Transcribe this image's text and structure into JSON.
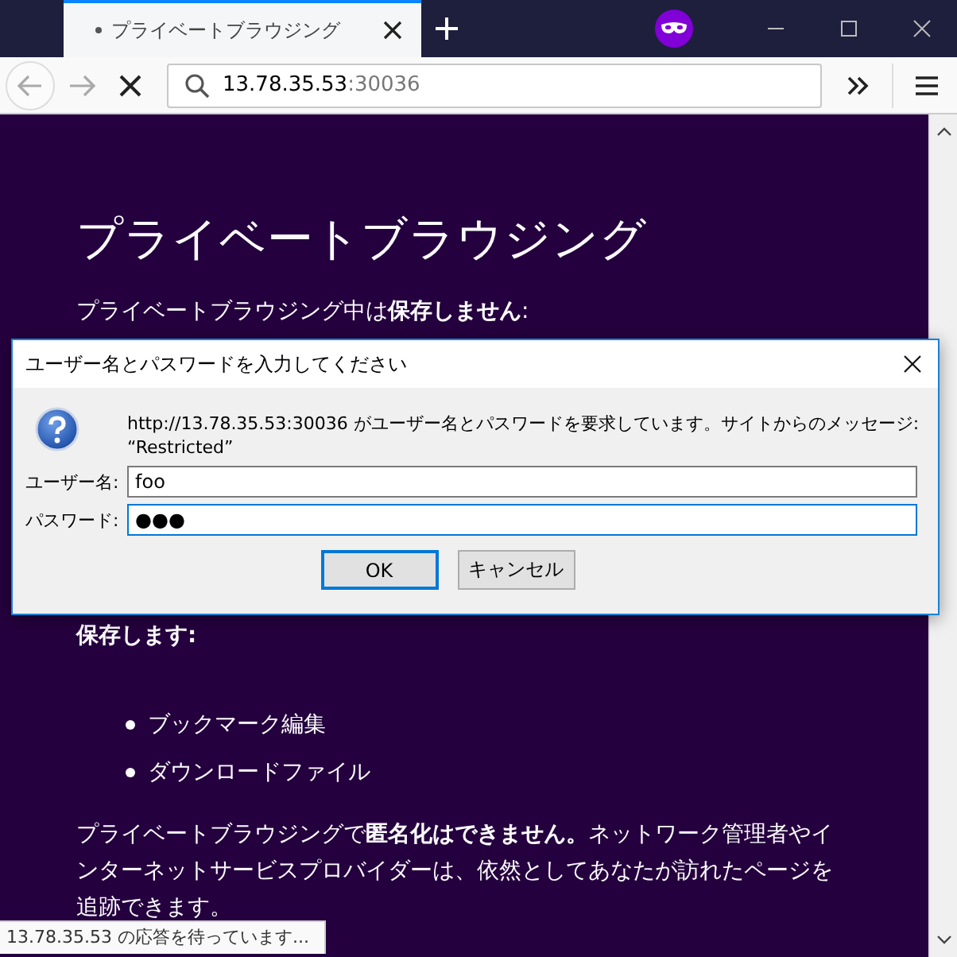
{
  "tab": {
    "title": "プライベートブラウジング",
    "loading": true,
    "selected": true
  },
  "address_bar": {
    "host": "13.78.35.53",
    "port": ":30036"
  },
  "page": {
    "heading": "プライベートブラウジング",
    "intro": "プライベートブラウジング中は**保存しません**:",
    "save_heading": "保存します:",
    "saved_items": [
      "ブックマーク編集",
      "ダウンロードファイル"
    ],
    "note": "プライベートブラウジングで**匿名化はできません。**ネットワーク管理者やインターネットサービスプロバイダーは、依然としてあなたが訪れたページを追跡できます。"
  },
  "dialog": {
    "title": "ユーザー名とパスワードを入力してください",
    "message_lines": [
      "http://13.78.35.53:30036 がユーザー名とパスワードを要求しています。サイトからのメッセージ:",
      "“Restricted”"
    ],
    "fields": [
      {
        "label": "ユーザー名:",
        "value": "foo",
        "focused": false
      },
      {
        "label": "パスワード:",
        "value": "●●●",
        "focused": true
      }
    ],
    "buttons": [
      {
        "label": "OK",
        "default": true
      },
      {
        "label": "キャンセル",
        "default": false
      }
    ]
  },
  "status_bar": "13.78.35.53 の応答を待っています..."
}
